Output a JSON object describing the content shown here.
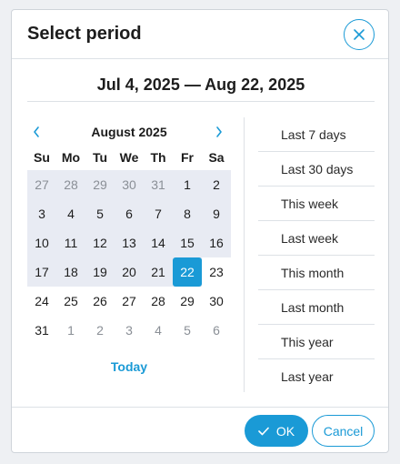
{
  "dialog": {
    "title": "Select period",
    "range_label": "Jul 4, 2025 — Aug 22, 2025"
  },
  "calendar": {
    "month_label": "August 2025",
    "weekdays": [
      "Su",
      "Mo",
      "Tu",
      "We",
      "Th",
      "Fr",
      "Sa"
    ],
    "weeks": [
      [
        {
          "d": "27",
          "out": true,
          "in": true
        },
        {
          "d": "28",
          "out": true,
          "in": true
        },
        {
          "d": "29",
          "out": true,
          "in": true
        },
        {
          "d": "30",
          "out": true,
          "in": true
        },
        {
          "d": "31",
          "out": true,
          "in": true
        },
        {
          "d": "1",
          "in": true
        },
        {
          "d": "2",
          "in": true
        }
      ],
      [
        {
          "d": "3",
          "in": true
        },
        {
          "d": "4",
          "in": true
        },
        {
          "d": "5",
          "in": true
        },
        {
          "d": "6",
          "in": true
        },
        {
          "d": "7",
          "in": true
        },
        {
          "d": "8",
          "in": true
        },
        {
          "d": "9",
          "in": true
        }
      ],
      [
        {
          "d": "10",
          "in": true
        },
        {
          "d": "11",
          "in": true
        },
        {
          "d": "12",
          "in": true
        },
        {
          "d": "13",
          "in": true
        },
        {
          "d": "14",
          "in": true
        },
        {
          "d": "15",
          "in": true
        },
        {
          "d": "16",
          "in": true
        }
      ],
      [
        {
          "d": "17",
          "in": true
        },
        {
          "d": "18",
          "in": true
        },
        {
          "d": "19",
          "in": true
        },
        {
          "d": "20",
          "in": true
        },
        {
          "d": "21",
          "in": true
        },
        {
          "d": "22",
          "sel": true
        },
        {
          "d": "23"
        }
      ],
      [
        {
          "d": "24"
        },
        {
          "d": "25"
        },
        {
          "d": "26"
        },
        {
          "d": "27"
        },
        {
          "d": "28"
        },
        {
          "d": "29"
        },
        {
          "d": "30"
        }
      ],
      [
        {
          "d": "31"
        },
        {
          "d": "1",
          "out": true
        },
        {
          "d": "2",
          "out": true
        },
        {
          "d": "3",
          "out": true
        },
        {
          "d": "4",
          "out": true
        },
        {
          "d": "5",
          "out": true
        },
        {
          "d": "6",
          "out": true
        }
      ]
    ],
    "today_label": "Today"
  },
  "presets": [
    "Last 7 days",
    "Last 30 days",
    "This week",
    "Last week",
    "This month",
    "Last month",
    "This year",
    "Last year"
  ],
  "footer": {
    "ok_label": "OK",
    "cancel_label": "Cancel"
  },
  "colors": {
    "accent": "#1a9ad6",
    "range_bg": "#e8ebf3"
  },
  "icons": {
    "close": "close-icon",
    "prev": "chevron-left-icon",
    "next": "chevron-right-icon",
    "ok": "check-icon"
  }
}
